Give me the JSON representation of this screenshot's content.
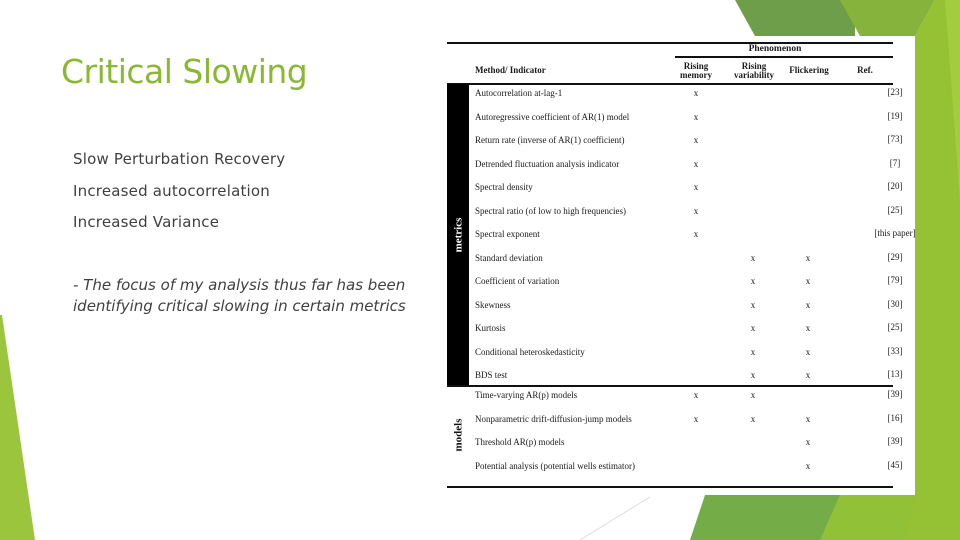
{
  "slide": {
    "title": "Critical Slowing",
    "bullets": [
      "Slow Perturbation Recovery",
      "Increased autocorrelation",
      "Increased Variance"
    ],
    "note": "- The focus of my analysis thus far has been identifying critical slowing in certain metrics",
    "colors": {
      "accent": "#8ab833",
      "text": "#404040",
      "green_dark": "#6f9e4a",
      "green_mid": "#7cb342",
      "green_light": "#9bc53d"
    }
  },
  "table": {
    "phenomenon_label": "Phenomenon",
    "headers": {
      "method": "Method/ Indicator",
      "rising_memory": [
        "Rising",
        "memory"
      ],
      "rising_variability": [
        "Rising",
        "variability"
      ],
      "flickering": "Flickering",
      "ref": "Ref."
    },
    "groups": [
      {
        "label": "metrics",
        "rows": [
          {
            "method": "Autocorrelation at-lag-1",
            "rising_memory": "x",
            "rising_variability": "",
            "flickering": "",
            "ref": "[23]"
          },
          {
            "method": "Autoregressive coefficient of AR(1) model",
            "rising_memory": "x",
            "rising_variability": "",
            "flickering": "",
            "ref": "[19]"
          },
          {
            "method": "Return rate (inverse of AR(1) coefficient)",
            "rising_memory": "x",
            "rising_variability": "",
            "flickering": "",
            "ref": "[73]"
          },
          {
            "method": "Detrended fluctuation analysis indicator",
            "rising_memory": "x",
            "rising_variability": "",
            "flickering": "",
            "ref": "[7]"
          },
          {
            "method": "Spectral density",
            "rising_memory": "x",
            "rising_variability": "",
            "flickering": "",
            "ref": "[20]"
          },
          {
            "method": "Spectral ratio (of low to high frequencies)",
            "rising_memory": "x",
            "rising_variability": "",
            "flickering": "",
            "ref": "[25]"
          },
          {
            "method": "Spectral exponent",
            "rising_memory": "x",
            "rising_variability": "",
            "flickering": "",
            "ref": "[this paper]"
          },
          {
            "method": "Standard deviation",
            "rising_memory": "",
            "rising_variability": "x",
            "flickering": "x",
            "ref": "[29]"
          },
          {
            "method": "Coefficient of variation",
            "rising_memory": "",
            "rising_variability": "x",
            "flickering": "x",
            "ref": "[79]"
          },
          {
            "method": "Skewness",
            "rising_memory": "",
            "rising_variability": "x",
            "flickering": "x",
            "ref": "[30]"
          },
          {
            "method": "Kurtosis",
            "rising_memory": "",
            "rising_variability": "x",
            "flickering": "x",
            "ref": "[25]"
          },
          {
            "method": "Conditional heteroskedasticity",
            "rising_memory": "",
            "rising_variability": "x",
            "flickering": "x",
            "ref": "[33]"
          },
          {
            "method": "BDS test",
            "rising_memory": "",
            "rising_variability": "x",
            "flickering": "x",
            "ref": "[13]"
          }
        ]
      },
      {
        "label": "models",
        "rows": [
          {
            "method": "Time-varying AR(p) models",
            "rising_memory": "x",
            "rising_variability": "x",
            "flickering": "",
            "ref": "[39]"
          },
          {
            "method": "Nonparametric drift-diffusion-jump models",
            "rising_memory": "x",
            "rising_variability": "x",
            "flickering": "x",
            "ref": "[16]"
          },
          {
            "method": "Threshold AR(p) models",
            "rising_memory": "",
            "rising_variability": "",
            "flickering": "x",
            "ref": "[39]"
          },
          {
            "method": "Potential analysis (potential wells estimator)",
            "rising_memory": "",
            "rising_variability": "",
            "flickering": "x",
            "ref": "[45]"
          }
        ]
      }
    ]
  }
}
